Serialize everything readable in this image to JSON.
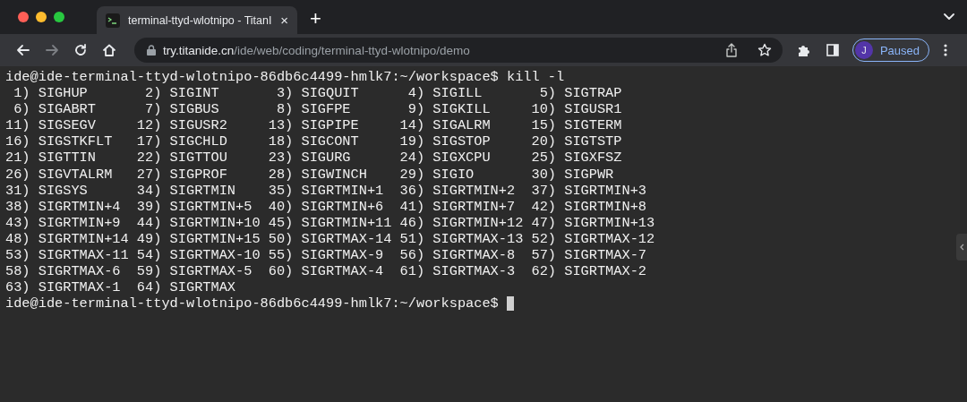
{
  "tab": {
    "title": "terminal-ttyd-wlotnipo - TitanI",
    "close": "×",
    "new": "+"
  },
  "address": {
    "host": "try.titanide.cn",
    "path": "/ide/web/coding/terminal-ttyd-wlotnipo/demo"
  },
  "profile": {
    "initial": "J",
    "label": "Paused"
  },
  "terminal": {
    "lines": [
      "ide@ide-terminal-ttyd-wlotnipo-86db6c4499-hmlk7:~/workspace$ kill -l",
      " 1) SIGHUP       2) SIGINT       3) SIGQUIT      4) SIGILL       5) SIGTRAP",
      " 6) SIGABRT      7) SIGBUS       8) SIGFPE       9) SIGKILL     10) SIGUSR1",
      "11) SIGSEGV     12) SIGUSR2     13) SIGPIPE     14) SIGALRM     15) SIGTERM",
      "16) SIGSTKFLT   17) SIGCHLD     18) SIGCONT     19) SIGSTOP     20) SIGTSTP",
      "21) SIGTTIN     22) SIGTTOU     23) SIGURG      24) SIGXCPU     25) SIGXFSZ",
      "26) SIGVTALRM   27) SIGPROF     28) SIGWINCH    29) SIGIO       30) SIGPWR",
      "31) SIGSYS      34) SIGRTMIN    35) SIGRTMIN+1  36) SIGRTMIN+2  37) SIGRTMIN+3",
      "38) SIGRTMIN+4  39) SIGRTMIN+5  40) SIGRTMIN+6  41) SIGRTMIN+7  42) SIGRTMIN+8",
      "43) SIGRTMIN+9  44) SIGRTMIN+10 45) SIGRTMIN+11 46) SIGRTMIN+12 47) SIGRTMIN+13",
      "48) SIGRTMIN+14 49) SIGRTMIN+15 50) SIGRTMAX-14 51) SIGRTMAX-13 52) SIGRTMAX-12",
      "53) SIGRTMAX-11 54) SIGRTMAX-10 55) SIGRTMAX-9  56) SIGRTMAX-8  57) SIGRTMAX-7",
      "58) SIGRTMAX-6  59) SIGRTMAX-5  60) SIGRTMAX-4  61) SIGRTMAX-3  62) SIGRTMAX-2",
      "63) SIGRTMAX-1  64) SIGRTMAX"
    ],
    "prompt": "ide@ide-terminal-ttyd-wlotnipo-86db6c4499-hmlk7:~/workspace$"
  }
}
